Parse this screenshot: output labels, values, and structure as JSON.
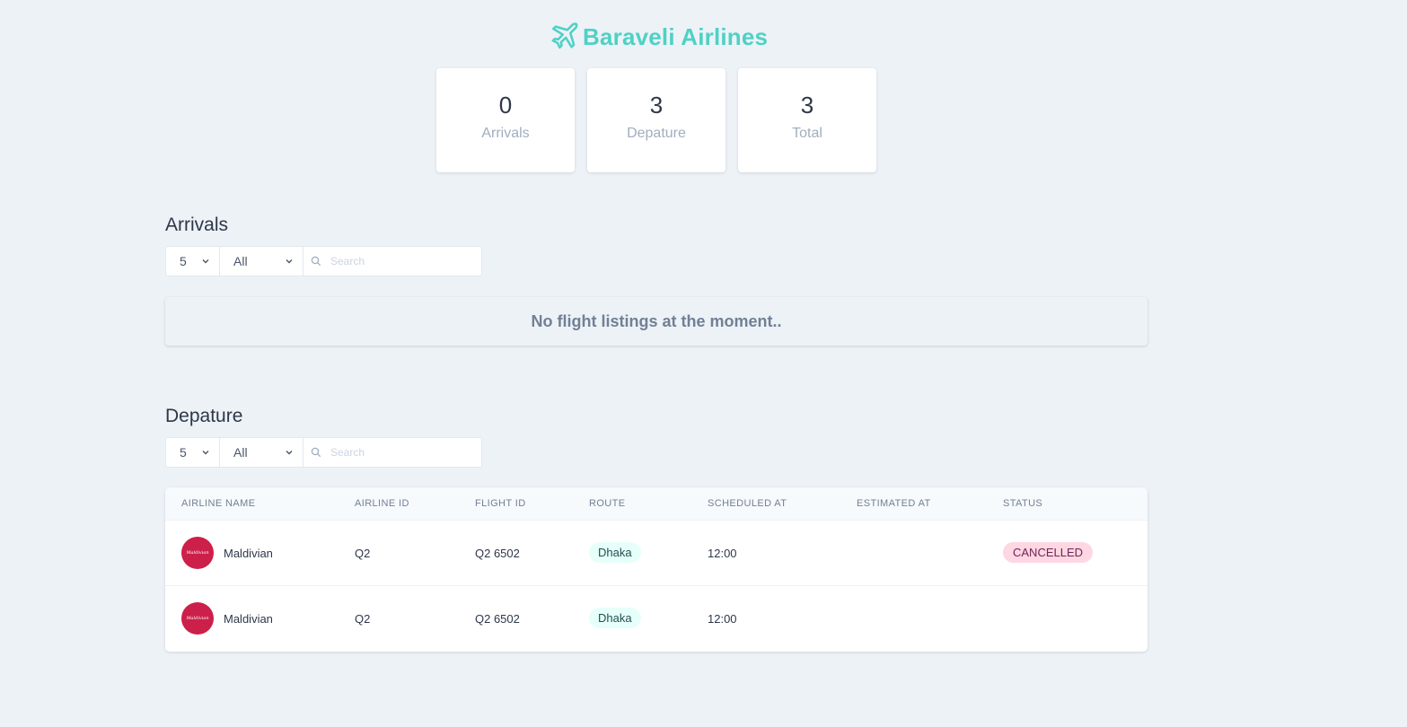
{
  "brand": {
    "name": "Baraveli Airlines",
    "icon": "airplane-icon",
    "color": "#4fd1c5"
  },
  "stats": [
    {
      "value": "0",
      "label": "Arrivals"
    },
    {
      "value": "3",
      "label": "Depature"
    },
    {
      "value": "3",
      "label": "Total"
    }
  ],
  "arrivals": {
    "title": "Arrivals",
    "rows_per_page": "5",
    "filter": "All",
    "search_placeholder": "Search",
    "empty_message": "No flight listings at the moment.."
  },
  "departures": {
    "title": "Depature",
    "rows_per_page": "5",
    "filter": "All",
    "search_placeholder": "Search",
    "columns": [
      "Airline Name",
      "Airline ID",
      "Flight ID",
      "Route",
      "Scheduled At",
      "Estimated At",
      "Status"
    ],
    "rows": [
      {
        "airline_name": "Maldivian",
        "logo_text": "Maldivian",
        "airline_id": "Q2",
        "flight_id": "Q2 6502",
        "route": "Dhaka",
        "scheduled_at": "12:00",
        "estimated_at": "",
        "status": "Cancelled"
      },
      {
        "airline_name": "Maldivian",
        "logo_text": "Maldivian",
        "airline_id": "Q2",
        "flight_id": "Q2 6502",
        "route": "Dhaka",
        "scheduled_at": "12:00",
        "estimated_at": "",
        "status": ""
      }
    ]
  }
}
